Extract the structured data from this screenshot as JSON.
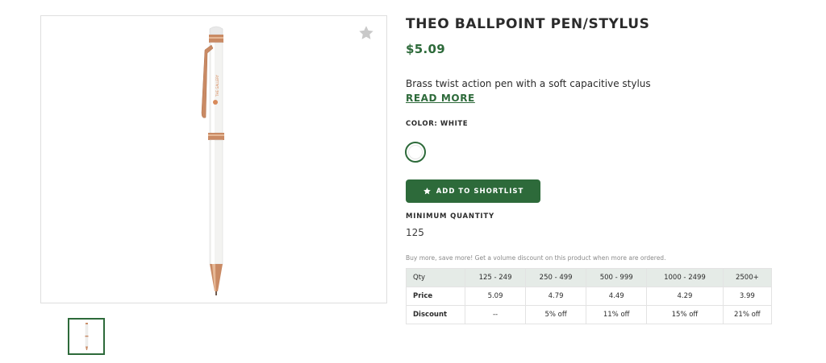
{
  "product": {
    "title": "THEO BALLPOINT PEN/STYLUS",
    "price": "$5.09",
    "description": "Brass twist action pen with a soft capacitive stylus",
    "read_more": "READ MORE",
    "color_label": "COLOR: WHITE",
    "selected_color": "#ffffff",
    "pen_logo_text": "THE GALLERY"
  },
  "actions": {
    "shortlist_label": "ADD TO SHORTLIST",
    "favorite_icon": "star-icon"
  },
  "minimum_quantity": {
    "label": "MINIMUM QUANTITY",
    "value": "125"
  },
  "volume": {
    "note": "Buy more, save more! Get a volume discount on this product when more are ordered.",
    "headers": [
      "Qty",
      "125 - 249",
      "250 - 499",
      "500 - 999",
      "1000 - 2499",
      "2500+"
    ],
    "price_row": [
      "Price",
      "5.09",
      "4.79",
      "4.49",
      "4.29",
      "3.99"
    ],
    "discount_row": [
      "Discount",
      "--",
      "5% off",
      "11% off",
      "15% off",
      "21% off"
    ]
  },
  "colors": {
    "accent": "#2d6a3a",
    "table_header_bg": "#e5ebe7",
    "rose_gold": "#c98a64"
  }
}
